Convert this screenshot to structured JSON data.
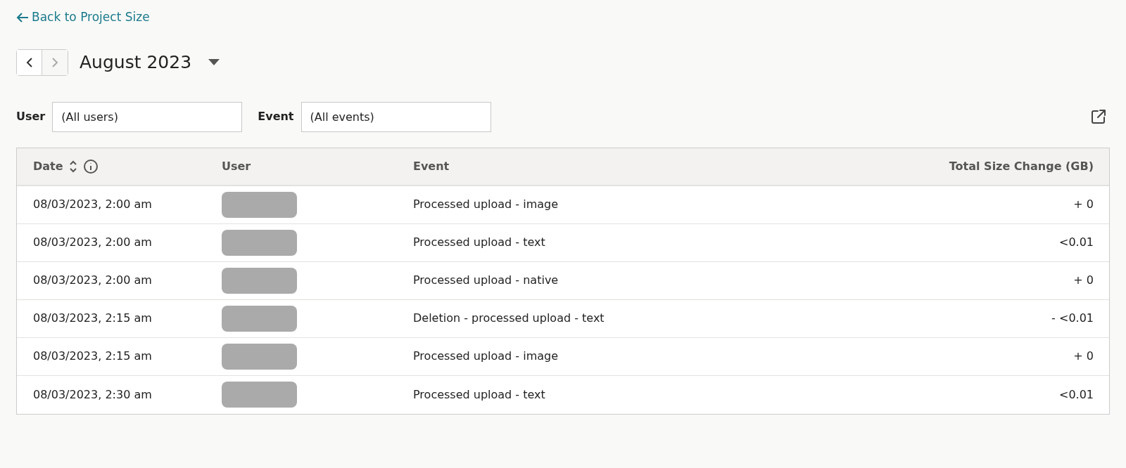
{
  "back_link": "Back to Project Size",
  "month_nav": {
    "prev_disabled": false,
    "next_disabled": true,
    "title": "August 2023"
  },
  "filters": [
    {
      "label": "User",
      "value": "(All users)"
    },
    {
      "label": "Event",
      "value": "(All events)"
    }
  ],
  "table": {
    "columns": [
      "Date",
      "User",
      "Event",
      "Total Size Change (GB)"
    ],
    "rows": [
      {
        "date": "08/03/2023, 2:00 am",
        "event": "Processed upload - image",
        "change": "+ 0"
      },
      {
        "date": "08/03/2023, 2:00 am",
        "event": "Processed upload - text",
        "change": "<0.01"
      },
      {
        "date": "08/03/2023, 2:00 am",
        "event": "Processed upload - native",
        "change": "+ 0"
      },
      {
        "date": "08/03/2023, 2:15 am",
        "event": "Deletion - processed upload - text",
        "change": "- <0.01"
      },
      {
        "date": "08/03/2023, 2:15 am",
        "event": "Processed upload - image",
        "change": "+ 0"
      },
      {
        "date": "08/03/2023, 2:30 am",
        "event": "Processed upload - text",
        "change": "<0.01"
      }
    ]
  }
}
